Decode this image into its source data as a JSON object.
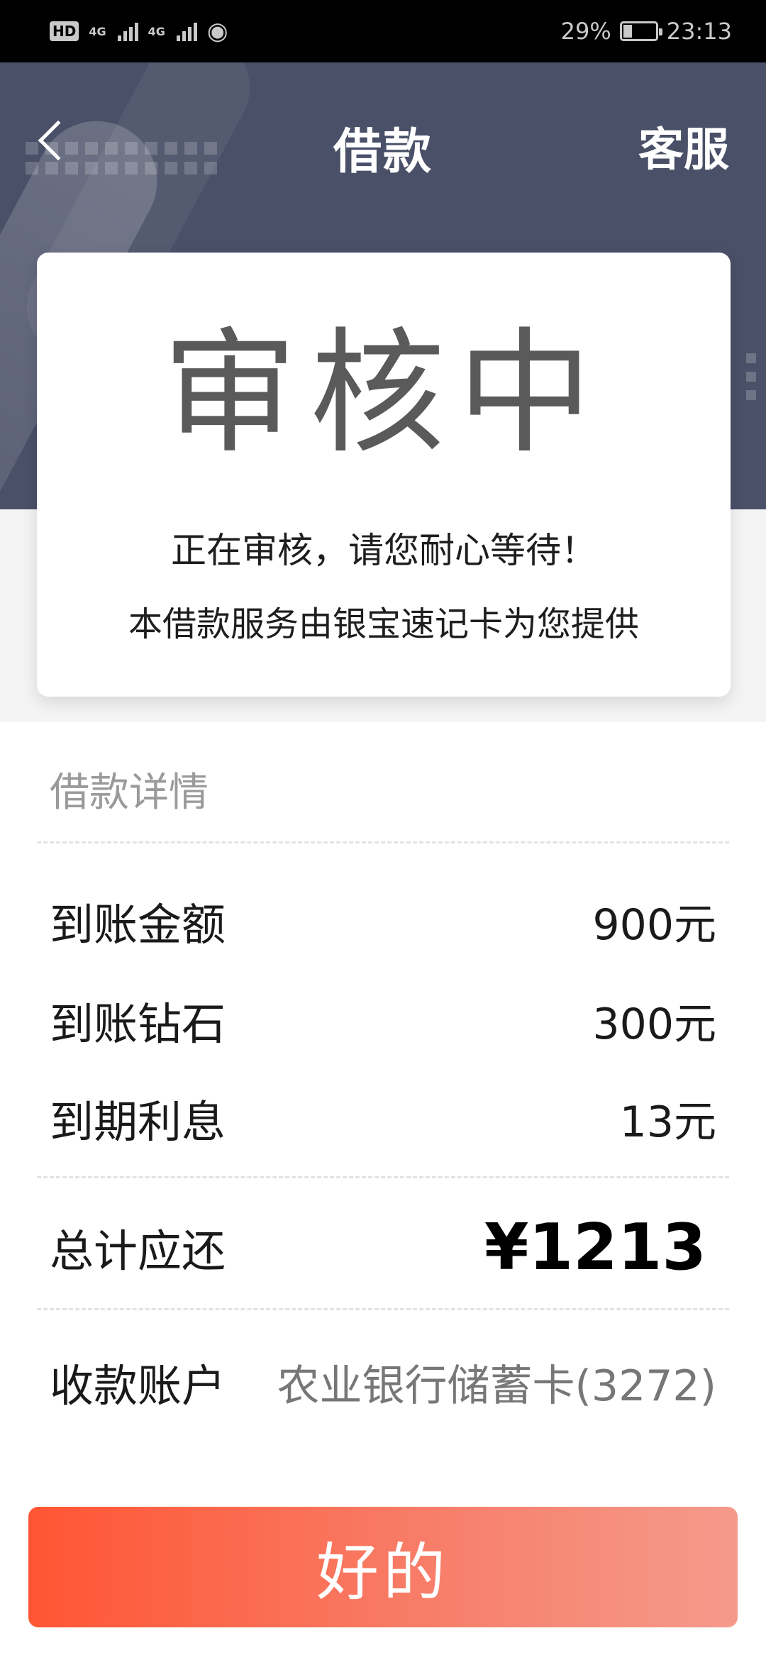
{
  "status_bar": {
    "hd": "HD",
    "network1": "4G",
    "network2": "4G",
    "battery": "29%",
    "time": "23:13"
  },
  "header": {
    "title": "借款",
    "service_label": "客服"
  },
  "status_card": {
    "title": "审核中",
    "message": "正在审核，请您耐心等待！",
    "provider": "本借款服务由银宝速记卡为您提供"
  },
  "details": {
    "section_title": "借款详情",
    "rows": [
      {
        "label": "到账金额",
        "value": "900元"
      },
      {
        "label": "到账钻石",
        "value": "300元"
      },
      {
        "label": "到期利息",
        "value": "13元"
      }
    ],
    "total": {
      "label": "总计应还",
      "value": "¥1213"
    },
    "account": {
      "label": "收款账户",
      "value": "农业银行储蓄卡(3272)"
    }
  },
  "action": {
    "ok_label": "好的"
  },
  "colors": {
    "header_bg": "#4a5068",
    "button_start": "#ff5533",
    "button_end": "#f59a8b"
  }
}
